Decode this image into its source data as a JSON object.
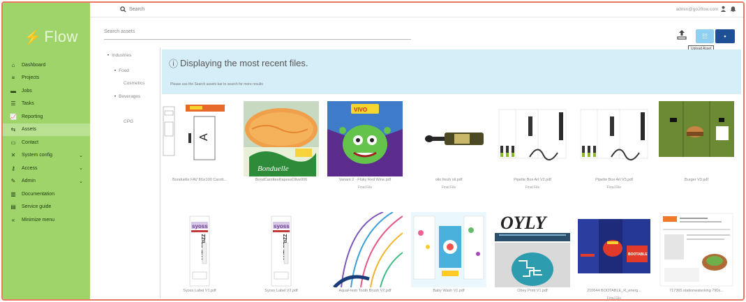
{
  "app": {
    "logo": "Flow"
  },
  "topbar": {
    "search_label": "Search",
    "user_email": "admin@go2flow.com"
  },
  "sidebar": {
    "items": [
      {
        "label": "Dashboard",
        "icon": "home-icon",
        "active": false,
        "has_chevron": false
      },
      {
        "label": "Projects",
        "icon": "database-icon",
        "active": false,
        "has_chevron": false
      },
      {
        "label": "Jobs",
        "icon": "jobs-icon",
        "active": false,
        "has_chevron": false
      },
      {
        "label": "Tasks",
        "icon": "tasks-icon",
        "active": false,
        "has_chevron": false
      },
      {
        "label": "Reporting",
        "icon": "chart-icon",
        "active": false,
        "has_chevron": false
      },
      {
        "label": "Assets",
        "icon": "assets-icon",
        "active": true,
        "has_chevron": false
      },
      {
        "label": "Contact",
        "icon": "contact-icon",
        "active": false,
        "has_chevron": false
      },
      {
        "label": "System config",
        "icon": "wrench-icon",
        "active": false,
        "has_chevron": true
      },
      {
        "label": "Access",
        "icon": "key-icon",
        "active": false,
        "has_chevron": true
      },
      {
        "label": "Admin",
        "icon": "pin-icon",
        "active": false,
        "has_chevron": true
      },
      {
        "label": "Documentation",
        "icon": "book-icon",
        "active": false,
        "has_chevron": false
      },
      {
        "label": "Service guide",
        "icon": "guide-icon",
        "active": false,
        "has_chevron": false
      },
      {
        "label": "Minimize menu",
        "icon": "minimize-icon",
        "active": false,
        "has_chevron": false
      }
    ]
  },
  "assets": {
    "search_placeholder": "Search assets",
    "upload_tooltip": "Upload Asset"
  },
  "tree": {
    "items": [
      {
        "label": "Industries",
        "level": 0,
        "bullet": true
      },
      {
        "label": "Food",
        "level": 1,
        "bullet": true
      },
      {
        "label": "Cosmetics",
        "level": 1,
        "bullet": false
      },
      {
        "label": "Beverages",
        "level": 1,
        "bullet": true
      },
      {
        "label": "CPG",
        "level": 1,
        "bullet": false
      }
    ]
  },
  "banner": {
    "title": "Displaying the most recent files.",
    "subtitle": "Please use the Search assets bar to search for more results"
  },
  "files": [
    {
      "name": "Bonduelle FAV 8Gx100 Carott...",
      "badge": "",
      "thumb": "label-drawing"
    },
    {
      "name": "BondCarottesRapeesOlive006",
      "badge": "",
      "thumb": "food-carrot"
    },
    {
      "name": "Variant 2 - Fluky Red Wine.pdf",
      "badge": "Final File",
      "thumb": "monster"
    },
    {
      "name": "olio fresh oil.pdf",
      "badge": "Final File",
      "thumb": "bottle"
    },
    {
      "name": "Pipette Box Art V2.pdf",
      "badge": "Final File",
      "thumb": "pipette"
    },
    {
      "name": "Pipette Box Art V3.pdf",
      "badge": "Final File",
      "thumb": "pipette"
    },
    {
      "name": "Burger V3.pdf",
      "badge": "",
      "thumb": "green-box"
    },
    {
      "name": "Syoss Label V1.pdf",
      "badge": "",
      "thumb": "syoss"
    },
    {
      "name": "Syoss Label V2.pdf",
      "badge": "",
      "thumb": "syoss"
    },
    {
      "name": "AquaFresh Tooth Brush V2.pdf",
      "badge": "",
      "thumb": "curves"
    },
    {
      "name": "Baby Wash V1.pdf",
      "badge": "",
      "thumb": "colorful"
    },
    {
      "name": "Obey Print V1.pdf",
      "badge": "",
      "thumb": "obey"
    },
    {
      "name": "210644 BOOTABLE_R_energ...",
      "badge": "Final File",
      "thumb": "blue-box"
    },
    {
      "name": "717365 stationwaterking 790x...",
      "badge": "",
      "thumb": "flyer"
    }
  ]
}
